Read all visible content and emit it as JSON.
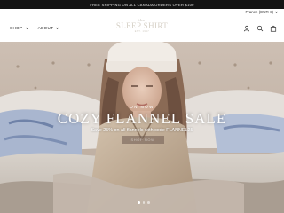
{
  "announcement": {
    "text": "FREE SHIPPING ON ALL CANADA ORDERS OVER $100"
  },
  "locale": {
    "currency_label": "France (EUR €)"
  },
  "nav": {
    "items": [
      {
        "label": "SHOP"
      },
      {
        "label": "ABOUT"
      }
    ]
  },
  "logo": {
    "prefix": "the",
    "name": "SLEEP SHIRT",
    "tagline": "EST. 1997"
  },
  "header_icons": [
    "user-icon",
    "search-icon",
    "bag-icon"
  ],
  "hero": {
    "eyebrow": "ON NOW",
    "headline": "COZY FLANNEL SALE",
    "subline": "Save 25% on all flannels with code FLANNEL25",
    "cta_label": "SHOP NOW",
    "slides_total": 3,
    "active_slide": 1
  },
  "colors": {
    "announcement_bg": "#141414",
    "text_dark": "#222222",
    "logo": "#d6d0c6"
  }
}
